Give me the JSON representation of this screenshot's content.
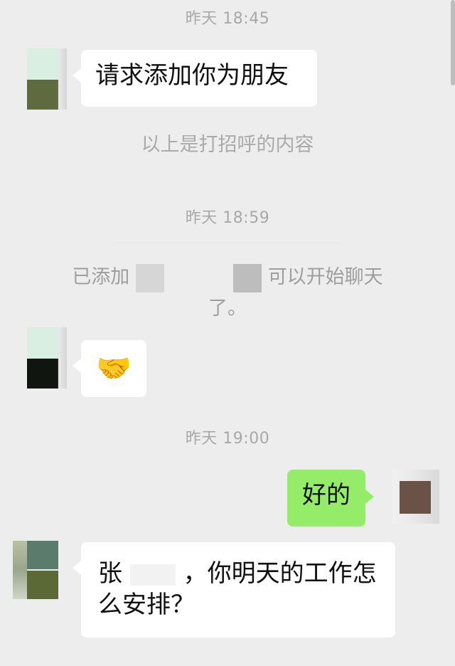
{
  "timestamps": {
    "t1": "昨天 18:45",
    "t2": "昨天 18:59",
    "t3": "昨天 19:00"
  },
  "messages": {
    "m1_text": "请求添加你为朋友",
    "m2_emoji": "🤝",
    "m3_text": "好的",
    "m4_line1_a": "张",
    "m4_line1_b": "，你明天的工作怎",
    "m4_line2": "么安排？"
  },
  "system": {
    "greeting_note": "以上是打招呼的内容",
    "added_prefix": "已添加",
    "added_suffix": "可以开始聊天",
    "added_line2": "了。"
  },
  "colors": {
    "background": "#ededed",
    "bubble_left": "#ffffff",
    "bubble_right": "#95ec69",
    "timestamp_text": "#a8a8a8"
  }
}
